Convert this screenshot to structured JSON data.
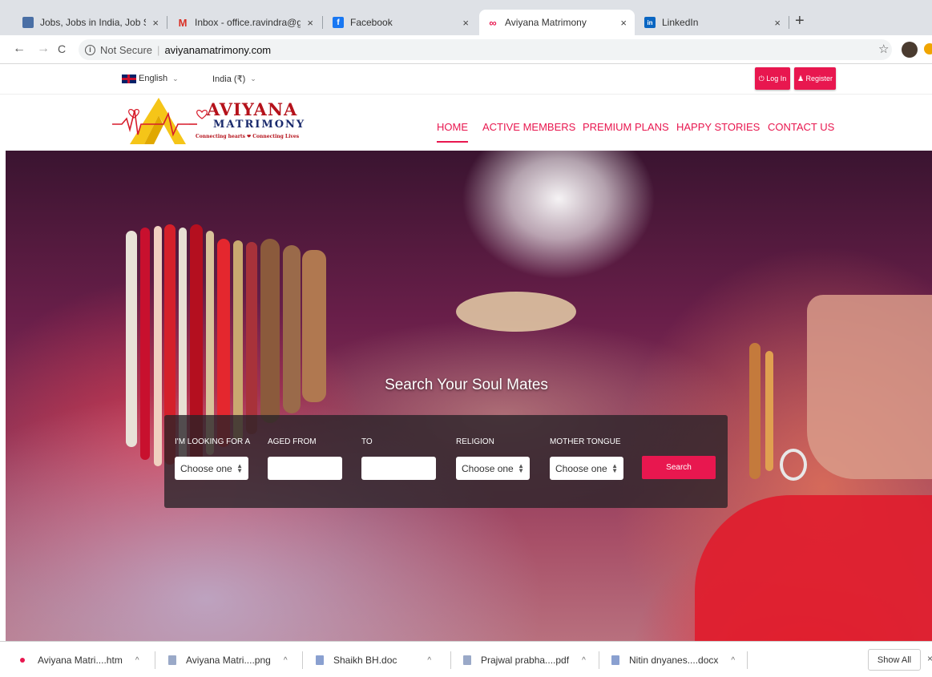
{
  "browser": {
    "tabs": [
      {
        "title": "Jobs, Jobs in India, Job Search",
        "close": "×",
        "icon": "jobs-favicon",
        "color": "#4a6fa5"
      },
      {
        "title": "Inbox - office.ravindra@gmail.c",
        "close": "×",
        "icon": "gmail-icon",
        "color": "#d93025"
      },
      {
        "title": "Facebook",
        "close": "×",
        "icon": "facebook-icon",
        "color": "#1877f2"
      },
      {
        "title": "Aviyana Matrimony",
        "close": "×",
        "icon": "aviyana-favicon",
        "color": "#e8174f"
      },
      {
        "title": "LinkedIn",
        "close": "×",
        "icon": "linkedin-icon",
        "color": "#0a66c2"
      }
    ],
    "new_tab": "+",
    "back": "←",
    "forward": "→",
    "reload": "C",
    "security": "Not Secure",
    "separator": "|",
    "url": "aviyanamatrimony.com",
    "bookmark": "☆"
  },
  "site": {
    "language": "English",
    "currency": "India (₹)",
    "login": "⏻ Log In",
    "register": "♟ Register",
    "logo": {
      "name": "AVIYANA",
      "sub": "MATRIMONY",
      "tagline": "Connecting hearts ❤ Connecting Lives"
    },
    "nav": [
      "HOME",
      "ACTIVE MEMBERS",
      "PREMIUM PLANS",
      "HAPPY STORIES",
      "CONTACT US"
    ],
    "accent": "#e8174f"
  },
  "hero": {
    "title": "Search Your Soul Mates",
    "search": {
      "looking_for_label": "I'M LOOKING FOR A",
      "looking_for_value": "Choose one",
      "aged_from_label": "AGED FROM",
      "to_label": "TO",
      "religion_label": "RELIGION",
      "religion_value": "Choose one",
      "mother_tongue_label": "MOTHER TONGUE",
      "mother_tongue_value": "Choose one",
      "search_button": "Search"
    }
  },
  "downloads": {
    "items": [
      {
        "name": "Aviyana Matri....htm"
      },
      {
        "name": "Aviyana Matri....png"
      },
      {
        "name": "Shaikh BH.doc"
      },
      {
        "name": "Prajwal prabha....pdf"
      },
      {
        "name": "Nitin dnyanes....docx"
      }
    ],
    "chevron": "^",
    "show_all": "Show All",
    "close": "×"
  }
}
